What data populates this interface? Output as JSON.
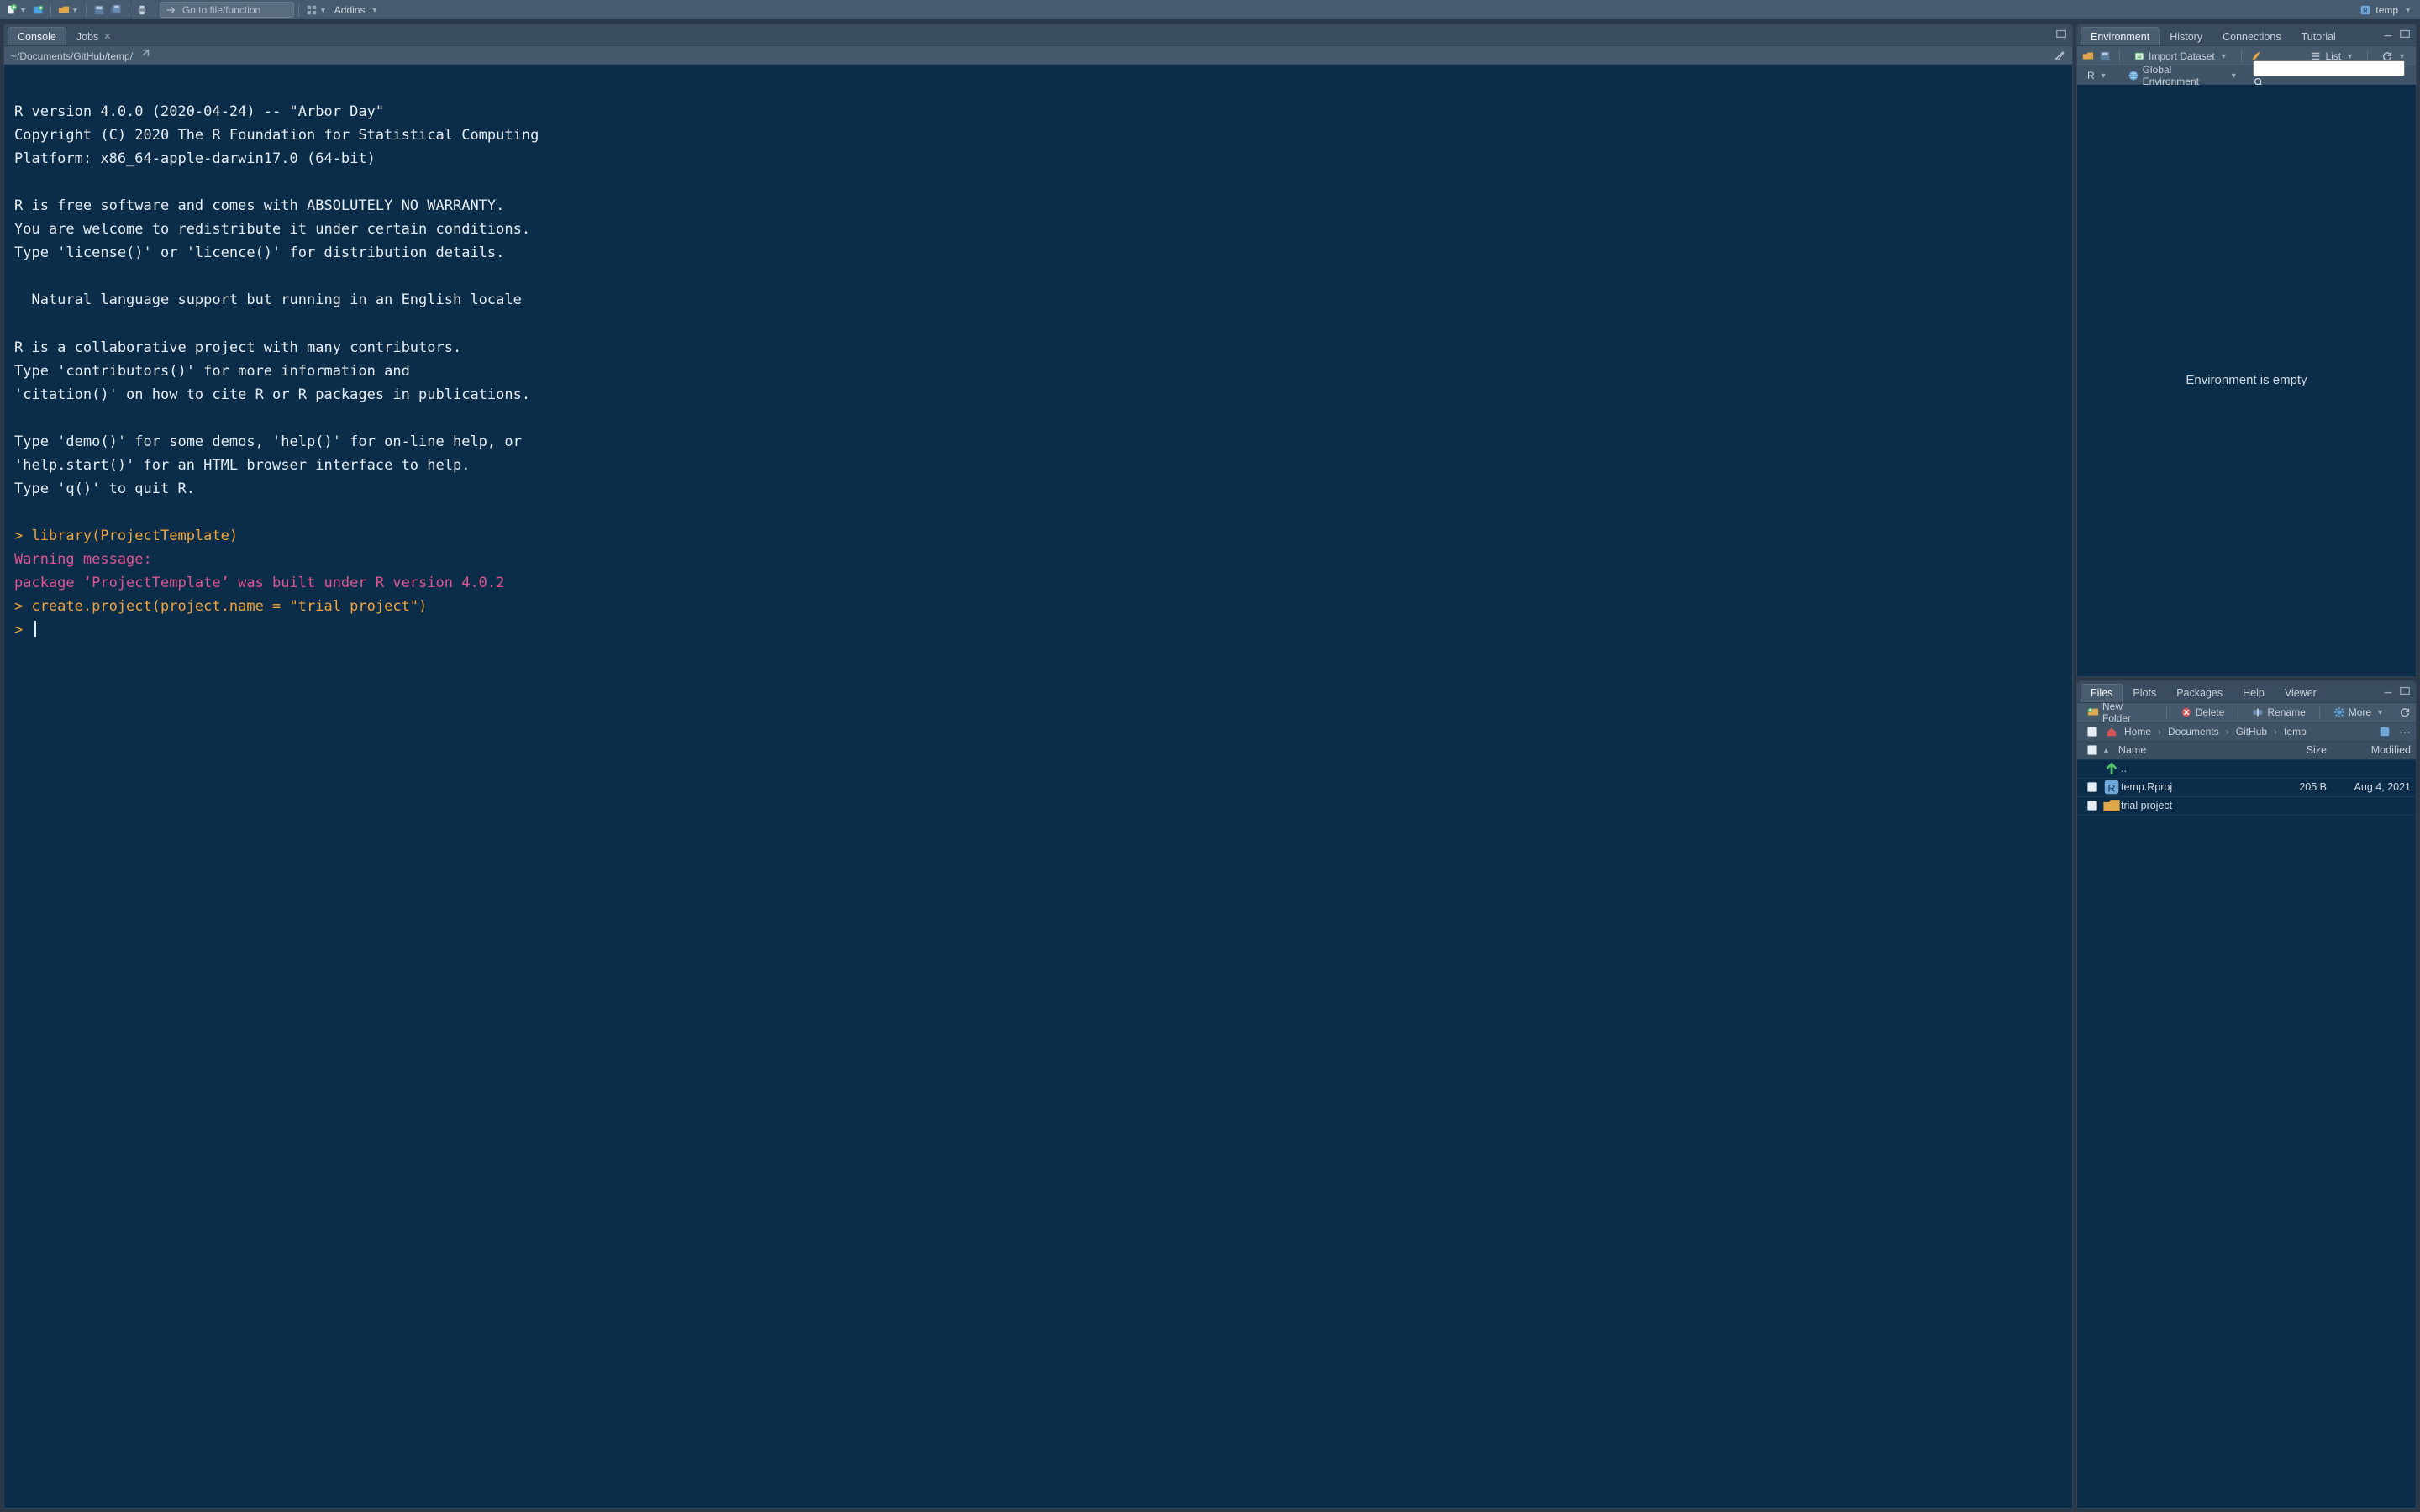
{
  "toolbar": {
    "gotofile_placeholder": "Go to file/function",
    "addins_label": "Addins",
    "project_label": "temp"
  },
  "left": {
    "tabs": [
      {
        "label": "Console",
        "active": true,
        "closable": false
      },
      {
        "label": "Jobs",
        "active": false,
        "closable": true
      }
    ],
    "path": "~/Documents/GitHub/temp/",
    "console_lines": [
      {
        "t": "",
        "c": "n"
      },
      {
        "t": "R version 4.0.0 (2020-04-24) -- \"Arbor Day\"",
        "c": "n"
      },
      {
        "t": "Copyright (C) 2020 The R Foundation for Statistical Computing",
        "c": "n"
      },
      {
        "t": "Platform: x86_64-apple-darwin17.0 (64-bit)",
        "c": "n"
      },
      {
        "t": "",
        "c": "n"
      },
      {
        "t": "R is free software and comes with ABSOLUTELY NO WARRANTY.",
        "c": "n"
      },
      {
        "t": "You are welcome to redistribute it under certain conditions.",
        "c": "n"
      },
      {
        "t": "Type 'license()' or 'licence()' for distribution details.",
        "c": "n"
      },
      {
        "t": "",
        "c": "n"
      },
      {
        "t": "  Natural language support but running in an English locale",
        "c": "n"
      },
      {
        "t": "",
        "c": "n"
      },
      {
        "t": "R is a collaborative project with many contributors.",
        "c": "n"
      },
      {
        "t": "Type 'contributors()' for more information and",
        "c": "n"
      },
      {
        "t": "'citation()' on how to cite R or R packages in publications.",
        "c": "n"
      },
      {
        "t": "",
        "c": "n"
      },
      {
        "t": "Type 'demo()' for some demos, 'help()' for on-line help, or",
        "c": "n"
      },
      {
        "t": "'help.start()' for an HTML browser interface to help.",
        "c": "n"
      },
      {
        "t": "Type 'q()' to quit R.",
        "c": "n"
      },
      {
        "t": "",
        "c": "n"
      },
      {
        "t": "> library(ProjectTemplate)",
        "c": "p"
      },
      {
        "t": "Warning message:",
        "c": "w"
      },
      {
        "t": "package ‘ProjectTemplate’ was built under R version 4.0.2 ",
        "c": "w"
      },
      {
        "t": "> create.project(project.name = \"trial project\")",
        "c": "p"
      },
      {
        "t": "> ",
        "c": "p",
        "cursor": true
      }
    ]
  },
  "env": {
    "tabs": [
      {
        "label": "Environment",
        "active": true
      },
      {
        "label": "History",
        "active": false
      },
      {
        "label": "Connections",
        "active": false
      },
      {
        "label": "Tutorial",
        "active": false
      }
    ],
    "import_label": "Import Dataset",
    "list_label": "List",
    "scope_r": "R",
    "scope_label": "Global Environment",
    "empty_msg": "Environment is empty"
  },
  "files": {
    "tabs": [
      {
        "label": "Files",
        "active": true
      },
      {
        "label": "Plots",
        "active": false
      },
      {
        "label": "Packages",
        "active": false
      },
      {
        "label": "Help",
        "active": false
      },
      {
        "label": "Viewer",
        "active": false
      }
    ],
    "btn_newfolder": "New Folder",
    "btn_delete": "Delete",
    "btn_rename": "Rename",
    "btn_more": "More",
    "breadcrumb": [
      "Home",
      "Documents",
      "GitHub",
      "temp"
    ],
    "cols": {
      "name": "Name",
      "size": "Size",
      "modified": "Modified"
    },
    "rows": [
      {
        "up": true,
        "name": ".."
      },
      {
        "icon": "rproj",
        "name": "temp.Rproj",
        "size": "205 B",
        "modified": "Aug 4, 2021"
      },
      {
        "icon": "folder",
        "name": "trial project",
        "size": "",
        "modified": ""
      }
    ]
  }
}
